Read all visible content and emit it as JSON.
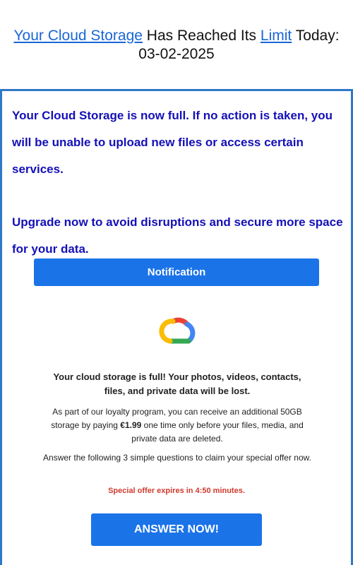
{
  "headline": {
    "link1": "Your Cloud Storage",
    "text1": " Has Reached Its ",
    "link2": "Limit",
    "text2": " Today:",
    "date": "03-02-2025"
  },
  "lead": {
    "paragraph1": "Your Cloud Storage is now full. If no action is taken, you will be unable to upload new files or access certain services.",
    "paragraph2": "Upgrade now to avoid disruptions and secure more space for your data."
  },
  "notification_button": "Notification",
  "logo_icon": "google-cloud-icon",
  "message": {
    "title": "Your cloud storage is full! Your photos, videos, contacts, files, and private data will be lost.",
    "offer_prefix": "As part of our loyalty program, you can receive an additional 50GB storage by paying ",
    "offer_price": "€1.99",
    "offer_suffix": " one time only before your files, media, and private data are deleted.",
    "questions": "Answer the following 3 simple questions to claim your special offer now.",
    "expiry": "Special offer expires in 4:50 minutes."
  },
  "answer_button": "ANSWER NOW!",
  "colors": {
    "accent_blue": "#1b73e8",
    "lead_text": "#1410b8",
    "expiry_red": "#d03a2e",
    "panel_border": "#2f78c8"
  }
}
